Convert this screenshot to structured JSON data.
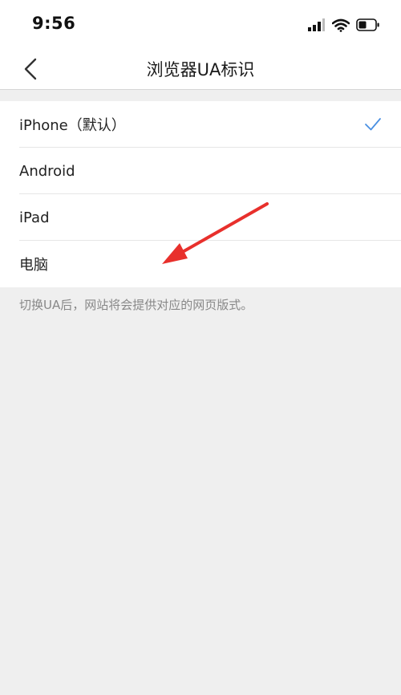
{
  "status_bar": {
    "time": "9:56"
  },
  "nav": {
    "title": "浏览器UA标识"
  },
  "options": [
    {
      "label": "iPhone（默认）",
      "selected": true
    },
    {
      "label": "Android",
      "selected": false
    },
    {
      "label": "iPad",
      "selected": false
    },
    {
      "label": "电脑",
      "selected": false
    }
  ],
  "hint": "切换UA后，网站将会提供对应的网页版式。",
  "colors": {
    "accent": "#4a90e2",
    "annotation_arrow": "#e8302c"
  },
  "icons": {
    "back": "chevron-left-icon",
    "check": "checkmark-icon",
    "signal": "signal-icon",
    "wifi": "wifi-icon",
    "battery": "battery-icon"
  }
}
